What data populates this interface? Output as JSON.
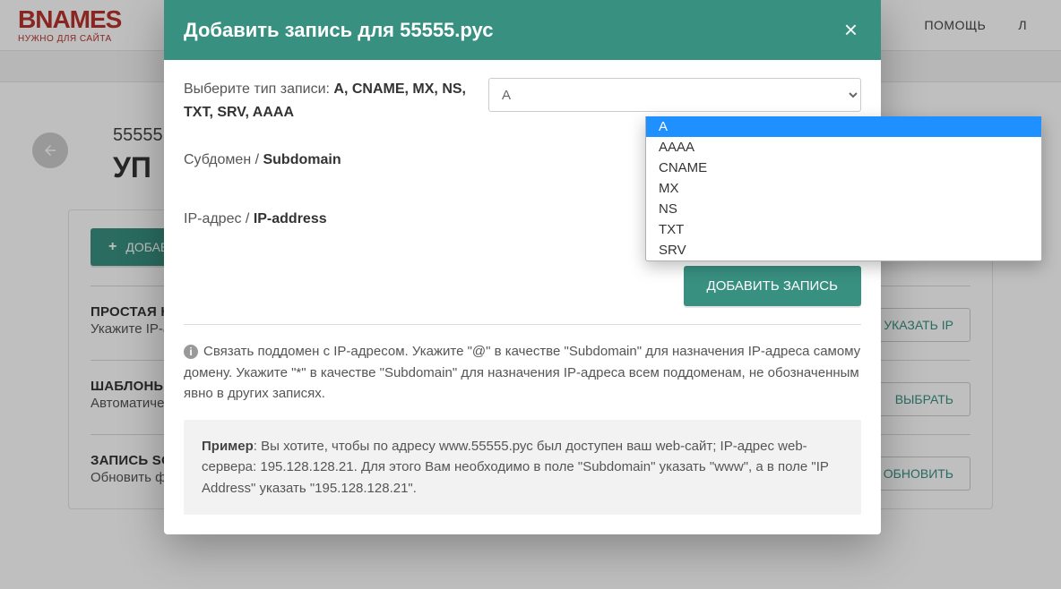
{
  "logo": {
    "main": "BNAMES",
    "sub": "НУЖНО ДЛЯ САЙТА"
  },
  "nav": {
    "help": "ПОМОЩЬ",
    "login_letter": "Л"
  },
  "breadcrumb": "55555",
  "page_title": "УП",
  "panel": {
    "add_btn": "ДОБАВИТ",
    "rows": [
      {
        "title": "ПРОСТАЯ НА",
        "desc": "Укажите IP-адр",
        "btn": "УКАЗАТЬ IP"
      },
      {
        "title": "ШАБЛОНЫ З",
        "desc": "Автоматическа",
        "btn": "ВЫБРАТЬ"
      },
      {
        "title": "ЗАПИСЬ SOA",
        "desc": "Обновить фай",
        "btn": "ОБНОВИТЬ"
      }
    ]
  },
  "modal": {
    "title": "Добавить запись для 55555.рус",
    "close": "×",
    "record_type_label_a": "Выберите тип записи: ",
    "record_type_label_b": "A, CNAME, MX, NS, TXT, SRV, AAAA",
    "record_type_selected": "A",
    "subdomain_label_a": "Субдомен / ",
    "subdomain_label_b": "Subdomain",
    "ip_label_a": "IP-адрес / ",
    "ip_label_b": "IP-address",
    "submit": "ДОБАВИТЬ ЗАПИСЬ",
    "info": "Связать поддомен с IP-адресом. Укажите \"@\" в качестве \"Subdomain\" для назначения IP-адреса самому домену. Укажите \"*\" в качестве \"Subdomain\" для назначения IP-адреса всем поддоменам, не обозначенным явно в других записях.",
    "example_label": "Пример",
    "example_text": ": Вы хотите, чтобы по адресу www.55555.рус был доступен ваш web-сайт; IP-адрес web-сервера: 195.128.128.21. Для этого Вам необходимо в поле \"Subdomain\" указать \"www\", а в поле \"IP Address\" указать \"195.128.128.21\".",
    "options": [
      "A",
      "AAAA",
      "CNAME",
      "MX",
      "NS",
      "TXT",
      "SRV"
    ]
  }
}
